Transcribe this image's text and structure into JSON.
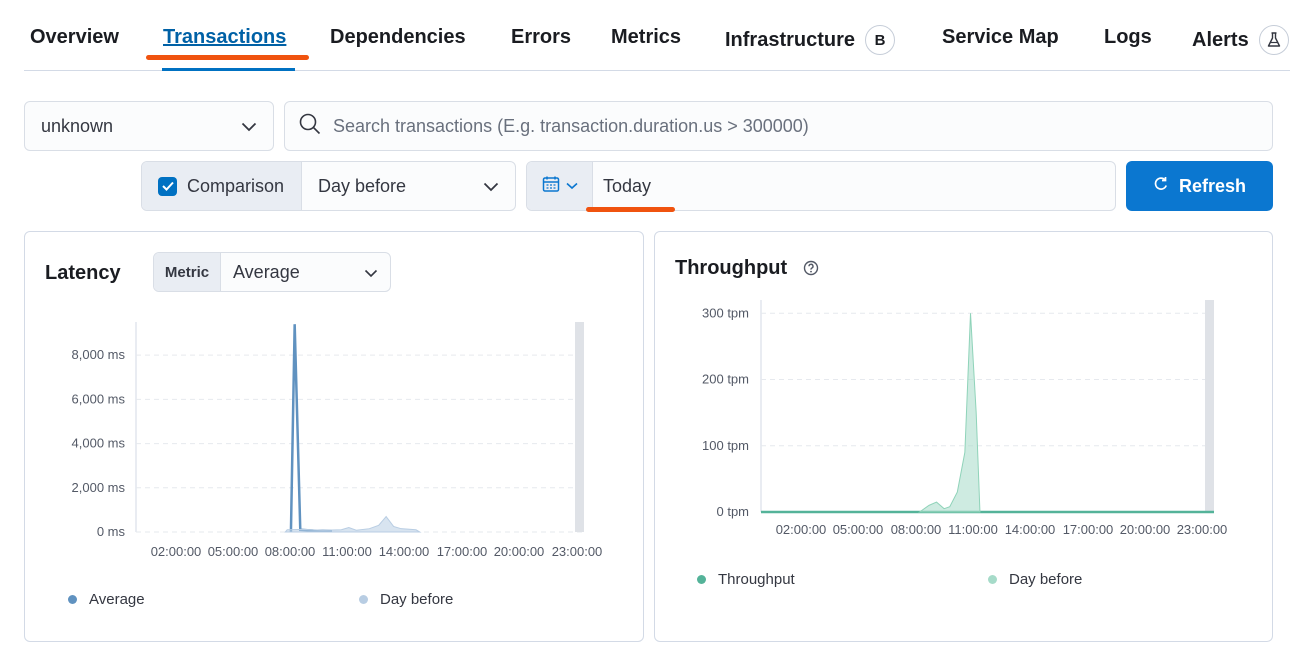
{
  "tabs": [
    {
      "label": "Overview",
      "selected": false
    },
    {
      "label": "Transactions",
      "selected": true
    },
    {
      "label": "Dependencies",
      "selected": false
    },
    {
      "label": "Errors",
      "selected": false
    },
    {
      "label": "Metrics",
      "selected": false
    },
    {
      "label": "Infrastructure",
      "selected": false,
      "badge": "B"
    },
    {
      "label": "Service Map",
      "selected": false
    },
    {
      "label": "Logs",
      "selected": false
    },
    {
      "label": "Alerts",
      "selected": false,
      "badge_icon": "beaker-icon"
    }
  ],
  "environment": {
    "value": "unknown"
  },
  "search": {
    "placeholder": "Search transactions (E.g. transaction.duration.us > 300000)"
  },
  "comparison": {
    "label": "Comparison",
    "checked": true,
    "value": "Day before"
  },
  "date": {
    "value": "Today"
  },
  "refresh": {
    "label": "Refresh"
  },
  "colors": {
    "accent": "#0b77d0",
    "annotation": "#f0530f",
    "latency": "#6092c0",
    "latency_prev": "#b8cde3",
    "throughput": "#54b399",
    "throughput_prev": "#a6dbc9"
  },
  "latency": {
    "title": "Latency",
    "metric_label": "Metric",
    "metric_value": "Average",
    "legend": [
      "Average",
      "Day before"
    ]
  },
  "throughput": {
    "title": "Throughput",
    "legend": [
      "Throughput",
      "Day before"
    ]
  },
  "chart_data": [
    {
      "type": "line",
      "title": "Latency",
      "y_ticks": [
        "0 ms",
        "2,000 ms",
        "4,000 ms",
        "6,000 ms",
        "8,000 ms"
      ],
      "ylim": [
        0,
        9500
      ],
      "x_ticks": [
        "02:00:00",
        "05:00:00",
        "08:00:00",
        "11:00:00",
        "14:00:00",
        "17:00:00",
        "20:00:00",
        "23:00:00"
      ],
      "x_range_hours": [
        0,
        24
      ],
      "series": [
        {
          "name": "Average",
          "style": "line",
          "points": [
            [
              8.3,
              0
            ],
            [
              8.5,
              9400
            ],
            [
              8.8,
              100
            ],
            [
              9.5,
              60
            ],
            [
              10.5,
              50
            ]
          ]
        },
        {
          "name": "Day before",
          "style": "area",
          "points": [
            [
              8.0,
              0
            ],
            [
              8.1,
              100
            ],
            [
              9.0,
              120
            ],
            [
              10.0,
              80
            ],
            [
              11.0,
              100
            ],
            [
              11.4,
              200
            ],
            [
              11.8,
              80
            ],
            [
              12.5,
              150
            ],
            [
              13.0,
              300
            ],
            [
              13.4,
              700
            ],
            [
              13.8,
              250
            ],
            [
              14.2,
              150
            ],
            [
              15.0,
              100
            ],
            [
              15.2,
              0
            ]
          ]
        }
      ],
      "grid": true
    },
    {
      "type": "area",
      "title": "Throughput",
      "y_ticks": [
        "0 tpm",
        "100 tpm",
        "200 tpm",
        "300 tpm"
      ],
      "ylim": [
        0,
        320
      ],
      "x_ticks": [
        "02:00:00",
        "05:00:00",
        "08:00:00",
        "11:00:00",
        "14:00:00",
        "17:00:00",
        "20:00:00",
        "23:00:00"
      ],
      "x_range_hours": [
        0,
        24
      ],
      "series": [
        {
          "name": "Throughput",
          "style": "line",
          "points": [
            [
              0,
              0
            ],
            [
              24,
              0
            ]
          ]
        },
        {
          "name": "Day before",
          "style": "area",
          "points": [
            [
              8.4,
              0
            ],
            [
              8.9,
              10
            ],
            [
              9.3,
              15
            ],
            [
              9.7,
              5
            ],
            [
              10.0,
              8
            ],
            [
              10.4,
              30
            ],
            [
              10.8,
              90
            ],
            [
              11.1,
              300
            ],
            [
              11.4,
              150
            ],
            [
              11.6,
              0
            ]
          ]
        }
      ],
      "grid": true
    }
  ]
}
